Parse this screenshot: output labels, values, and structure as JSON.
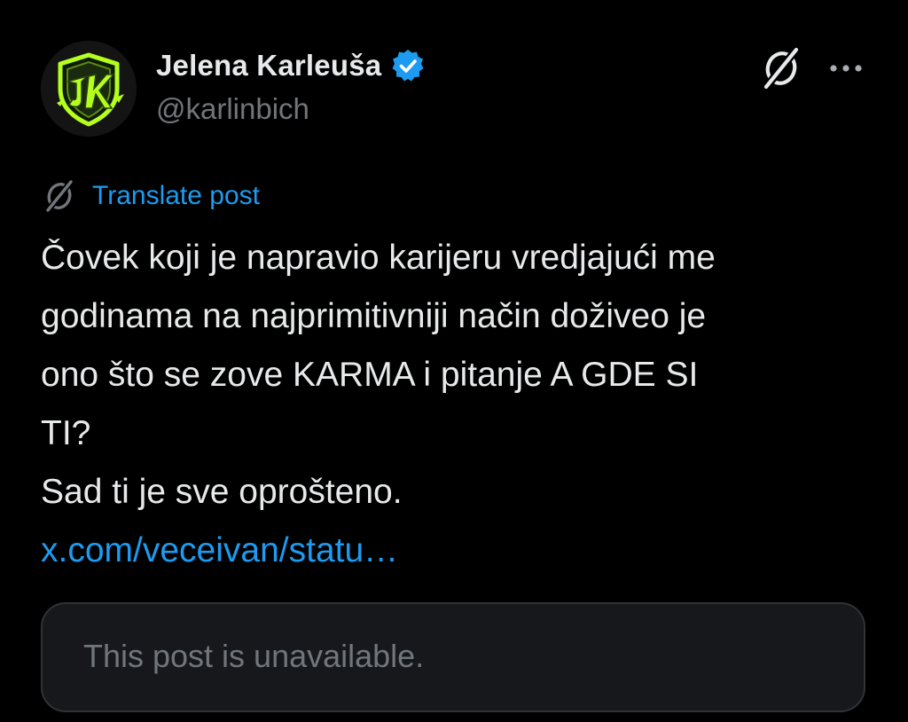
{
  "author": {
    "display_name": "Jelena Karleuša",
    "handle": "@karlinbich",
    "verified": true,
    "avatar_icon": "jk-logo-shield-icon",
    "verified_icon": "verified-badge-icon"
  },
  "actions": {
    "grok_icon": "grok-icon",
    "more_icon": "more-dots-icon"
  },
  "translate": {
    "icon": "grok-icon",
    "label": "Translate post"
  },
  "post": {
    "lines": [
      "Čovek koji je napravio karijeru vredjajući me",
      "godinama na najprimitivniji način doživeo je",
      "ono što se zove KARMA i pitanje A GDE SI",
      "TI?",
      "Sad ti je sve oprošteno."
    ],
    "link": "x.com/veceivan/statu…"
  },
  "quote": {
    "text": "This post is unavailable."
  },
  "colors": {
    "background": "#000000",
    "text_primary": "#e7e9ea",
    "text_secondary": "#71767b",
    "accent": "#1d9bf0",
    "card_bg": "#16181c",
    "card_border": "#2f3336",
    "logo_green": "#b5ff1e"
  }
}
